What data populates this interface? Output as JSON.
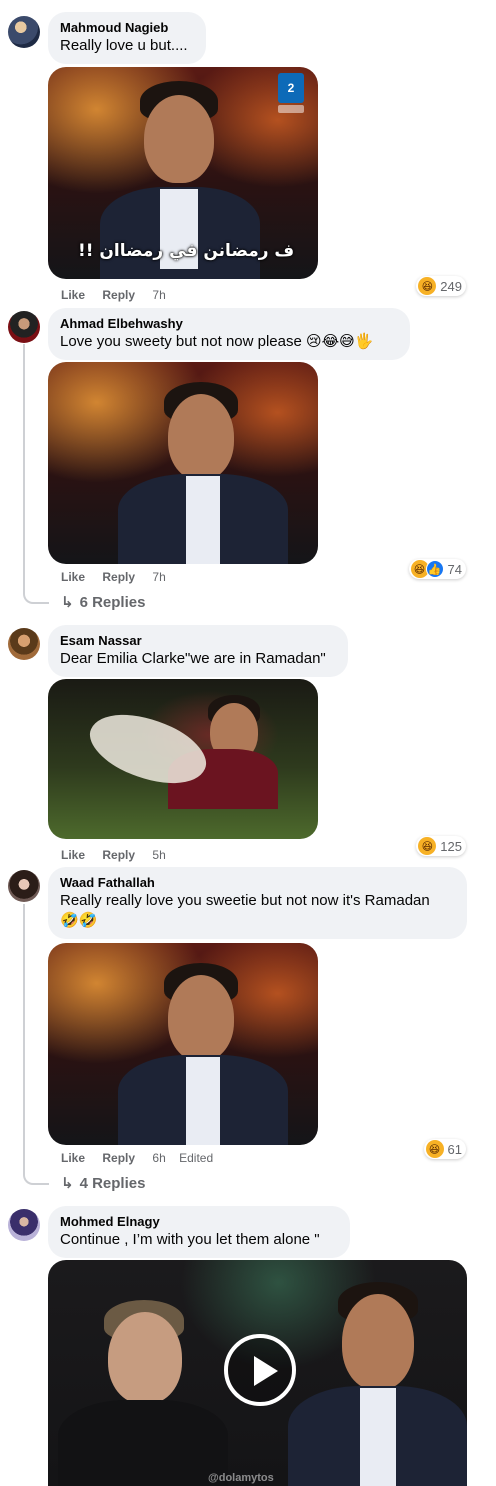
{
  "comments": [
    {
      "author": "Mahmoud Nagieb",
      "text": "Really love u but....",
      "media_caption": "ف رمضانن في رمضاان !!",
      "channel_logo": "2",
      "like": "Like",
      "reply": "Reply",
      "time": "7h",
      "reaction_count": "249",
      "reactions": [
        "haha-icon"
      ]
    },
    {
      "author": "Ahmad Elbehwashy",
      "text": "Love you sweety but not now please 😢😂😅🖐",
      "like": "Like",
      "reply": "Reply",
      "time": "7h",
      "reaction_count": "74",
      "reactions": [
        "haha-icon",
        "like-icon"
      ],
      "replies": "6 Replies"
    },
    {
      "author": "Esam Nassar",
      "text": "Dear Emilia Clarke\"we are in Ramadan\"",
      "like": "Like",
      "reply": "Reply",
      "time": "5h",
      "reaction_count": "125",
      "reactions": [
        "haha-icon"
      ]
    },
    {
      "author": "Waad Fathallah",
      "text": "Really really love you sweetie but not now it's Ramadan",
      "text_line2": "🤣🤣",
      "like": "Like",
      "reply": "Reply",
      "time": "6h",
      "edited": "Edited",
      "reaction_count": "61",
      "reactions": [
        "haha-icon"
      ],
      "replies": "4 Replies"
    },
    {
      "author": "Mohmed Elnagy",
      "text": "Continue , I’m with you let them alone \"",
      "video_watermark": "@dolamytos"
    }
  ],
  "colors": {
    "bubble": "#f0f2f5",
    "meta": "#65676b",
    "like_blue": "#1877f2",
    "haha_yellow": "#f7b125"
  }
}
